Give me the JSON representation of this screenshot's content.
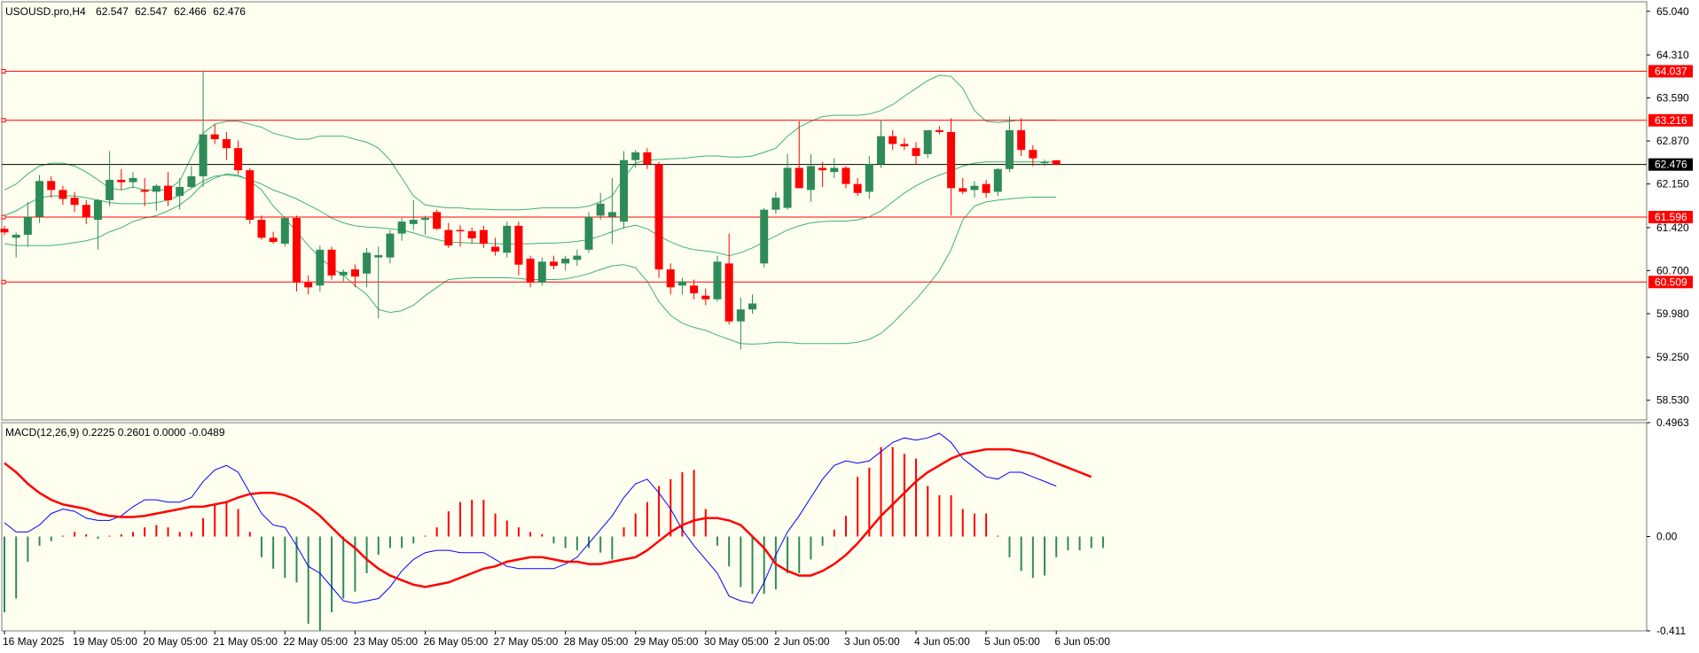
{
  "header": {
    "symbol_info": "USOUSD.pro,H4",
    "o": "62.547",
    "h": "62.547",
    "l": "62.466",
    "c": "62.476"
  },
  "colors": {
    "bull": "#2e8b57",
    "bear": "#ff0000",
    "band": "#3cb371",
    "level": "#ff0000",
    "current": "#000000",
    "macd_line": "#0000ff",
    "signal_line": "#ff0000",
    "background": "#fffff0"
  },
  "chart_data": [
    {
      "type": "candlestick",
      "title": "USOUSD.pro,H4  62.547 62.547 62.466 62.476",
      "timeframe": "H4",
      "ylim": [
        58.2,
        65.2
      ],
      "yticks": [
        "65.040",
        "64.310",
        "63.590",
        "62.870",
        "62.150",
        "61.420",
        "60.700",
        "59.980",
        "59.250",
        "58.530"
      ],
      "x_tick_labels": [
        "16 May 2025",
        "19 May 05:00",
        "20 May 05:00",
        "21 May 05:00",
        "22 May 05:00",
        "23 May 05:00",
        "26 May 05:00",
        "27 May 05:00",
        "28 May 05:00",
        "29 May 05:00",
        "30 May 05:00",
        "2 Jun 05:00",
        "3 Jun 05:00",
        "4 Jun 05:00",
        "5 Jun 05:00",
        "6 Jun 05:00"
      ],
      "x_tick_index": [
        0,
        6,
        12,
        18,
        24,
        30,
        36,
        42,
        48,
        54,
        60,
        66,
        72,
        78,
        84,
        90
      ],
      "horizontal_levels": [
        "64.037",
        "63.216",
        "61.596",
        "60.509"
      ],
      "current_price": "62.476",
      "candles": [
        [
          61.4,
          61.45,
          61.3,
          61.34
        ],
        [
          61.25,
          61.34,
          60.92,
          61.3
        ],
        [
          61.3,
          61.85,
          61.1,
          61.6
        ],
        [
          61.6,
          62.3,
          61.5,
          62.2
        ],
        [
          62.2,
          62.28,
          61.92,
          62.05
        ],
        [
          62.05,
          62.12,
          61.8,
          61.9
        ],
        [
          61.92,
          62.02,
          61.68,
          61.8
        ],
        [
          61.8,
          61.88,
          61.48,
          61.6
        ],
        [
          61.55,
          61.9,
          61.05,
          61.88
        ],
        [
          61.88,
          62.7,
          61.78,
          62.22
        ],
        [
          62.22,
          62.4,
          62.05,
          62.18
        ],
        [
          62.18,
          62.35,
          62.08,
          62.25
        ],
        [
          62.05,
          62.25,
          61.78,
          62.02
        ],
        [
          62.02,
          62.15,
          61.7,
          62.12
        ],
        [
          62.12,
          62.35,
          61.78,
          61.88
        ],
        [
          61.95,
          62.25,
          61.72,
          62.1
        ],
        [
          62.1,
          62.45,
          62.08,
          62.28
        ],
        [
          62.28,
          64.05,
          62.1,
          62.98
        ],
        [
          62.98,
          63.15,
          62.82,
          62.9
        ],
        [
          62.9,
          63.02,
          62.55,
          62.75
        ],
        [
          62.75,
          62.88,
          62.32,
          62.38
        ],
        [
          62.38,
          62.42,
          61.48,
          61.55
        ],
        [
          61.55,
          61.62,
          61.22,
          61.25
        ],
        [
          61.25,
          61.35,
          61.15,
          61.18
        ],
        [
          61.15,
          61.6,
          61.1,
          61.58
        ],
        [
          61.58,
          61.62,
          60.35,
          60.5
        ],
        [
          60.5,
          60.62,
          60.3,
          60.42
        ],
        [
          60.45,
          61.12,
          60.35,
          61.05
        ],
        [
          61.05,
          61.1,
          60.55,
          60.62
        ],
        [
          60.62,
          60.72,
          60.52,
          60.68
        ],
        [
          60.72,
          60.8,
          60.42,
          60.6
        ],
        [
          60.65,
          61.08,
          60.42,
          61.0
        ],
        [
          60.92,
          61.1,
          59.9,
          60.96
        ],
        [
          60.92,
          61.38,
          60.82,
          61.32
        ],
        [
          61.32,
          61.58,
          61.2,
          61.52
        ],
        [
          61.48,
          61.88,
          61.38,
          61.55
        ],
        [
          61.55,
          61.62,
          61.3,
          61.58
        ],
        [
          61.68,
          61.72,
          61.38,
          61.4
        ],
        [
          61.38,
          61.5,
          61.08,
          61.12
        ],
        [
          61.38,
          61.46,
          61.1,
          61.36
        ],
        [
          61.36,
          61.42,
          61.16,
          61.24
        ],
        [
          61.38,
          61.45,
          61.08,
          61.15
        ],
        [
          61.1,
          61.25,
          60.95,
          61.02
        ],
        [
          61.0,
          61.52,
          60.92,
          61.45
        ],
        [
          61.45,
          61.52,
          60.62,
          60.8
        ],
        [
          60.9,
          60.95,
          60.42,
          60.5
        ],
        [
          60.5,
          60.92,
          60.45,
          60.85
        ],
        [
          60.85,
          60.95,
          60.72,
          60.78
        ],
        [
          60.82,
          60.95,
          60.7,
          60.9
        ],
        [
          60.88,
          61.05,
          60.78,
          60.95
        ],
        [
          61.05,
          61.68,
          61.0,
          61.6
        ],
        [
          61.62,
          62.0,
          61.55,
          61.82
        ],
        [
          61.6,
          62.25,
          61.15,
          61.68
        ],
        [
          61.52,
          62.7,
          61.4,
          62.55
        ],
        [
          62.55,
          62.72,
          62.42,
          62.68
        ],
        [
          62.68,
          62.75,
          62.4,
          62.48
        ],
        [
          62.48,
          62.52,
          60.58,
          60.72
        ],
        [
          60.72,
          60.82,
          60.3,
          60.42
        ],
        [
          60.45,
          60.58,
          60.3,
          60.52
        ],
        [
          60.45,
          60.55,
          60.22,
          60.32
        ],
        [
          60.28,
          60.4,
          60.12,
          60.22
        ],
        [
          60.22,
          60.95,
          60.18,
          60.85
        ],
        [
          60.82,
          61.32,
          59.8,
          59.85
        ],
        [
          59.85,
          60.25,
          59.38,
          60.05
        ],
        [
          60.05,
          60.3,
          59.98,
          60.15
        ],
        [
          60.82,
          61.75,
          60.75,
          61.72
        ],
        [
          61.72,
          62.02,
          61.65,
          61.92
        ],
        [
          61.75,
          62.65,
          61.72,
          62.42
        ],
        [
          62.42,
          63.2,
          62.1,
          62.08
        ],
        [
          62.05,
          62.65,
          61.85,
          62.45
        ],
        [
          62.42,
          62.52,
          62.1,
          62.38
        ],
        [
          62.35,
          62.58,
          62.25,
          62.42
        ],
        [
          62.42,
          62.45,
          62.08,
          62.15
        ],
        [
          62.15,
          62.25,
          61.95,
          62.0
        ],
        [
          62.02,
          62.62,
          61.9,
          62.48
        ],
        [
          62.48,
          63.22,
          62.42,
          62.95
        ],
        [
          62.95,
          63.05,
          62.72,
          62.82
        ],
        [
          62.82,
          62.92,
          62.72,
          62.78
        ],
        [
          62.75,
          62.85,
          62.48,
          62.62
        ],
        [
          62.65,
          63.05,
          62.58,
          63.05
        ],
        [
          63.05,
          63.12,
          62.98,
          63.02
        ],
        [
          63.02,
          63.25,
          61.62,
          62.08
        ],
        [
          62.08,
          62.25,
          61.98,
          62.02
        ],
        [
          62.05,
          62.2,
          61.92,
          62.12
        ],
        [
          62.15,
          62.22,
          61.92,
          62.0
        ],
        [
          62.02,
          62.42,
          61.95,
          62.4
        ],
        [
          62.4,
          63.28,
          62.35,
          63.05
        ],
        [
          63.05,
          63.25,
          62.62,
          62.72
        ],
        [
          62.72,
          62.8,
          62.45,
          62.58
        ],
        [
          62.5,
          62.56,
          62.45,
          62.52
        ],
        [
          62.547,
          62.547,
          62.466,
          62.476
        ]
      ],
      "bollinger": {
        "upper": [
          62.05,
          62.15,
          62.32,
          62.45,
          62.5,
          62.5,
          62.45,
          62.35,
          62.22,
          62.08,
          62.05,
          62.1,
          62.05,
          62.05,
          62.05,
          62.2,
          62.6,
          63.0,
          63.15,
          63.2,
          63.2,
          63.15,
          63.1,
          63.0,
          62.95,
          62.9,
          62.9,
          62.95,
          62.95,
          62.95,
          62.9,
          62.85,
          62.75,
          62.55,
          62.25,
          61.95,
          61.8,
          61.77,
          61.75,
          61.75,
          61.73,
          61.73,
          61.72,
          61.72,
          61.72,
          61.73,
          61.75,
          61.75,
          61.75,
          61.75,
          61.78,
          61.85,
          61.95,
          62.25,
          62.5,
          62.55,
          62.56,
          62.57,
          62.58,
          62.6,
          62.62,
          62.62,
          62.6,
          62.6,
          62.62,
          62.68,
          62.75,
          62.95,
          63.1,
          63.2,
          63.28,
          63.3,
          63.3,
          63.3,
          63.32,
          63.38,
          63.48,
          63.62,
          63.75,
          63.88,
          63.97,
          63.95,
          63.75,
          63.38,
          63.2,
          63.18,
          63.2,
          63.22,
          63.22,
          63.22,
          63.22
        ],
        "middle": [
          61.62,
          61.7,
          61.82,
          61.92,
          61.95,
          61.95,
          61.95,
          61.92,
          61.88,
          61.84,
          61.82,
          61.82,
          61.82,
          61.84,
          61.88,
          61.96,
          62.08,
          62.2,
          62.28,
          62.3,
          62.28,
          62.22,
          62.15,
          62.05,
          61.98,
          61.9,
          61.8,
          61.7,
          61.58,
          61.5,
          61.45,
          61.43,
          61.42,
          61.4,
          61.38,
          61.33,
          61.27,
          61.22,
          61.18,
          61.17,
          61.16,
          61.16,
          61.15,
          61.15,
          61.15,
          61.15,
          61.16,
          61.16,
          61.17,
          61.19,
          61.22,
          61.28,
          61.35,
          61.42,
          61.46,
          61.4,
          61.28,
          61.18,
          61.1,
          61.05,
          61.03,
          61.0,
          60.95,
          61.0,
          61.08,
          61.18,
          61.28,
          61.38,
          61.45,
          61.5,
          61.52,
          61.53,
          61.53,
          61.55,
          61.6,
          61.7,
          61.85,
          62.0,
          62.12,
          62.22,
          62.3,
          62.37,
          62.45,
          62.5,
          62.52,
          62.52,
          62.52,
          62.52,
          62.52,
          62.52,
          62.52
        ],
        "lower": [
          61.15,
          61.12,
          61.12,
          61.12,
          61.12,
          61.14,
          61.17,
          61.2,
          61.25,
          61.35,
          61.42,
          61.52,
          61.58,
          61.62,
          61.7,
          61.8,
          61.95,
          62.15,
          62.25,
          62.32,
          62.3,
          62.2,
          62.05,
          61.78,
          61.58,
          61.35,
          61.12,
          60.92,
          60.75,
          60.62,
          60.45,
          60.3,
          60.05,
          60.0,
          60.03,
          60.12,
          60.28,
          60.42,
          60.55,
          60.57,
          60.58,
          60.58,
          60.58,
          60.58,
          60.57,
          60.55,
          60.55,
          60.55,
          60.56,
          60.6,
          60.65,
          60.72,
          60.78,
          60.8,
          60.75,
          60.52,
          60.18,
          59.95,
          59.82,
          59.75,
          59.7,
          59.62,
          59.55,
          59.48,
          59.47,
          59.48,
          59.5,
          59.5,
          59.48,
          59.48,
          59.48,
          59.48,
          59.48,
          59.5,
          59.55,
          59.65,
          59.82,
          60.02,
          60.22,
          60.45,
          60.7,
          61.05,
          61.55,
          61.78,
          61.85,
          61.88,
          61.9,
          61.92,
          61.93,
          61.93,
          61.93
        ]
      }
    },
    {
      "type": "macd",
      "title": "MACD(12,26,9) 0.2225 0.2601 0.0000 -0.0489",
      "ylim": [
        -0.411,
        0.4963
      ],
      "yticks": [
        "0.4963",
        "0.00",
        "-0.411"
      ],
      "macd_line": [
        0.06,
        0.02,
        0.02,
        0.05,
        0.1,
        0.12,
        0.11,
        0.08,
        0.07,
        0.07,
        0.09,
        0.13,
        0.16,
        0.16,
        0.15,
        0.15,
        0.17,
        0.24,
        0.29,
        0.31,
        0.28,
        0.19,
        0.1,
        0.05,
        0.04,
        -0.04,
        -0.13,
        -0.16,
        -0.22,
        -0.28,
        -0.29,
        -0.28,
        -0.27,
        -0.22,
        -0.15,
        -0.1,
        -0.07,
        -0.06,
        -0.06,
        -0.07,
        -0.07,
        -0.07,
        -0.1,
        -0.13,
        -0.14,
        -0.14,
        -0.14,
        -0.14,
        -0.12,
        -0.09,
        -0.03,
        0.03,
        0.09,
        0.17,
        0.23,
        0.25,
        0.19,
        0.12,
        0.03,
        -0.04,
        -0.1,
        -0.16,
        -0.26,
        -0.28,
        -0.29,
        -0.2,
        -0.08,
        0.02,
        0.09,
        0.17,
        0.25,
        0.31,
        0.33,
        0.32,
        0.33,
        0.37,
        0.41,
        0.43,
        0.42,
        0.43,
        0.45,
        0.41,
        0.34,
        0.3,
        0.26,
        0.25,
        0.28,
        0.28,
        0.26,
        0.24,
        0.22
      ],
      "signal_line": [
        0.32,
        0.28,
        0.23,
        0.19,
        0.16,
        0.14,
        0.13,
        0.12,
        0.1,
        0.09,
        0.085,
        0.085,
        0.09,
        0.1,
        0.11,
        0.12,
        0.13,
        0.13,
        0.14,
        0.15,
        0.17,
        0.185,
        0.19,
        0.19,
        0.18,
        0.16,
        0.13,
        0.09,
        0.04,
        -0.01,
        -0.05,
        -0.1,
        -0.14,
        -0.17,
        -0.19,
        -0.21,
        -0.22,
        -0.21,
        -0.2,
        -0.18,
        -0.16,
        -0.14,
        -0.13,
        -0.11,
        -0.1,
        -0.09,
        -0.09,
        -0.1,
        -0.11,
        -0.11,
        -0.12,
        -0.12,
        -0.11,
        -0.1,
        -0.09,
        -0.06,
        -0.02,
        0.02,
        0.05,
        0.07,
        0.08,
        0.08,
        0.07,
        0.05,
        0.0,
        -0.05,
        -0.12,
        -0.15,
        -0.17,
        -0.17,
        -0.15,
        -0.12,
        -0.08,
        -0.03,
        0.03,
        0.09,
        0.14,
        0.19,
        0.24,
        0.28,
        0.31,
        0.34,
        0.36,
        0.37,
        0.38,
        0.38,
        0.38,
        0.37,
        0.36,
        0.34,
        0.32,
        0.3,
        0.28,
        0.26
      ],
      "histogram": [
        -0.33,
        -0.27,
        -0.11,
        -0.04,
        -0.02,
        0.0,
        0.02,
        0.01,
        -0.01,
        0.0,
        0.01,
        0.02,
        0.04,
        0.05,
        0.04,
        0.02,
        0.02,
        0.08,
        0.14,
        0.15,
        0.12,
        0.02,
        -0.09,
        -0.14,
        -0.18,
        -0.2,
        -0.38,
        -0.41,
        -0.33,
        -0.27,
        -0.24,
        -0.16,
        -0.08,
        -0.05,
        -0.05,
        -0.03,
        0.0,
        0.04,
        0.11,
        0.15,
        0.16,
        0.16,
        0.1,
        0.07,
        0.04,
        0.02,
        0.01,
        -0.03,
        -0.05,
        -0.06,
        -0.05,
        -0.07,
        -0.1,
        0.04,
        0.1,
        0.15,
        0.22,
        0.25,
        0.28,
        0.29,
        0.12,
        -0.04,
        -0.13,
        -0.22,
        -0.25,
        -0.25,
        -0.23,
        -0.16,
        -0.16,
        -0.1,
        -0.04,
        0.03,
        0.09,
        0.26,
        0.3,
        0.39,
        0.39,
        0.36,
        0.34,
        0.22,
        0.18,
        0.18,
        0.12,
        0.1,
        0.1,
        0.0,
        -0.09,
        -0.15,
        -0.18,
        -0.17,
        -0.09,
        -0.06,
        -0.06,
        -0.05,
        -0.05
      ]
    }
  ]
}
